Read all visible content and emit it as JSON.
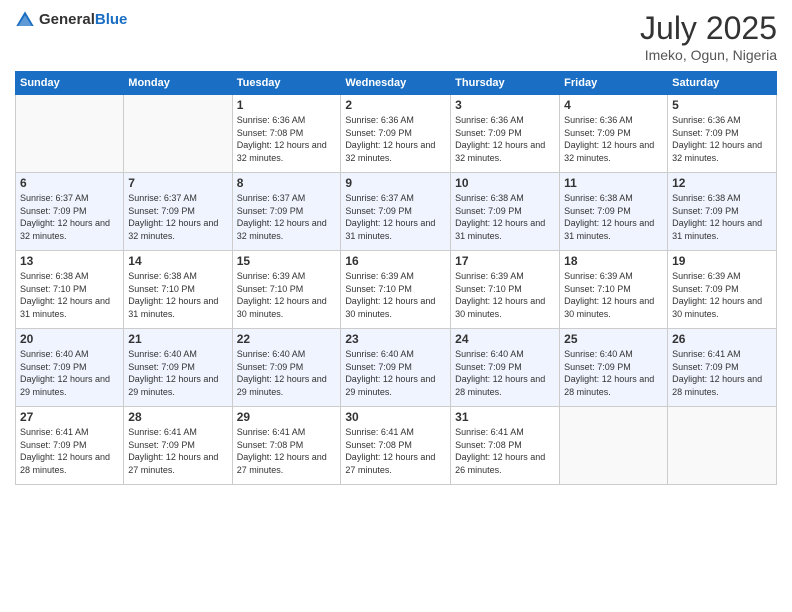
{
  "logo": {
    "general": "General",
    "blue": "Blue"
  },
  "title": {
    "month_year": "July 2025",
    "location": "Imeko, Ogun, Nigeria"
  },
  "weekdays": [
    "Sunday",
    "Monday",
    "Tuesday",
    "Wednesday",
    "Thursday",
    "Friday",
    "Saturday"
  ],
  "weeks": [
    [
      {
        "day": "",
        "sunrise": "",
        "sunset": "",
        "daylight": ""
      },
      {
        "day": "",
        "sunrise": "",
        "sunset": "",
        "daylight": ""
      },
      {
        "day": "1",
        "sunrise": "Sunrise: 6:36 AM",
        "sunset": "Sunset: 7:08 PM",
        "daylight": "Daylight: 12 hours and 32 minutes."
      },
      {
        "day": "2",
        "sunrise": "Sunrise: 6:36 AM",
        "sunset": "Sunset: 7:09 PM",
        "daylight": "Daylight: 12 hours and 32 minutes."
      },
      {
        "day": "3",
        "sunrise": "Sunrise: 6:36 AM",
        "sunset": "Sunset: 7:09 PM",
        "daylight": "Daylight: 12 hours and 32 minutes."
      },
      {
        "day": "4",
        "sunrise": "Sunrise: 6:36 AM",
        "sunset": "Sunset: 7:09 PM",
        "daylight": "Daylight: 12 hours and 32 minutes."
      },
      {
        "day": "5",
        "sunrise": "Sunrise: 6:36 AM",
        "sunset": "Sunset: 7:09 PM",
        "daylight": "Daylight: 12 hours and 32 minutes."
      }
    ],
    [
      {
        "day": "6",
        "sunrise": "Sunrise: 6:37 AM",
        "sunset": "Sunset: 7:09 PM",
        "daylight": "Daylight: 12 hours and 32 minutes."
      },
      {
        "day": "7",
        "sunrise": "Sunrise: 6:37 AM",
        "sunset": "Sunset: 7:09 PM",
        "daylight": "Daylight: 12 hours and 32 minutes."
      },
      {
        "day": "8",
        "sunrise": "Sunrise: 6:37 AM",
        "sunset": "Sunset: 7:09 PM",
        "daylight": "Daylight: 12 hours and 32 minutes."
      },
      {
        "day": "9",
        "sunrise": "Sunrise: 6:37 AM",
        "sunset": "Sunset: 7:09 PM",
        "daylight": "Daylight: 12 hours and 31 minutes."
      },
      {
        "day": "10",
        "sunrise": "Sunrise: 6:38 AM",
        "sunset": "Sunset: 7:09 PM",
        "daylight": "Daylight: 12 hours and 31 minutes."
      },
      {
        "day": "11",
        "sunrise": "Sunrise: 6:38 AM",
        "sunset": "Sunset: 7:09 PM",
        "daylight": "Daylight: 12 hours and 31 minutes."
      },
      {
        "day": "12",
        "sunrise": "Sunrise: 6:38 AM",
        "sunset": "Sunset: 7:09 PM",
        "daylight": "Daylight: 12 hours and 31 minutes."
      }
    ],
    [
      {
        "day": "13",
        "sunrise": "Sunrise: 6:38 AM",
        "sunset": "Sunset: 7:10 PM",
        "daylight": "Daylight: 12 hours and 31 minutes."
      },
      {
        "day": "14",
        "sunrise": "Sunrise: 6:38 AM",
        "sunset": "Sunset: 7:10 PM",
        "daylight": "Daylight: 12 hours and 31 minutes."
      },
      {
        "day": "15",
        "sunrise": "Sunrise: 6:39 AM",
        "sunset": "Sunset: 7:10 PM",
        "daylight": "Daylight: 12 hours and 30 minutes."
      },
      {
        "day": "16",
        "sunrise": "Sunrise: 6:39 AM",
        "sunset": "Sunset: 7:10 PM",
        "daylight": "Daylight: 12 hours and 30 minutes."
      },
      {
        "day": "17",
        "sunrise": "Sunrise: 6:39 AM",
        "sunset": "Sunset: 7:10 PM",
        "daylight": "Daylight: 12 hours and 30 minutes."
      },
      {
        "day": "18",
        "sunrise": "Sunrise: 6:39 AM",
        "sunset": "Sunset: 7:10 PM",
        "daylight": "Daylight: 12 hours and 30 minutes."
      },
      {
        "day": "19",
        "sunrise": "Sunrise: 6:39 AM",
        "sunset": "Sunset: 7:09 PM",
        "daylight": "Daylight: 12 hours and 30 minutes."
      }
    ],
    [
      {
        "day": "20",
        "sunrise": "Sunrise: 6:40 AM",
        "sunset": "Sunset: 7:09 PM",
        "daylight": "Daylight: 12 hours and 29 minutes."
      },
      {
        "day": "21",
        "sunrise": "Sunrise: 6:40 AM",
        "sunset": "Sunset: 7:09 PM",
        "daylight": "Daylight: 12 hours and 29 minutes."
      },
      {
        "day": "22",
        "sunrise": "Sunrise: 6:40 AM",
        "sunset": "Sunset: 7:09 PM",
        "daylight": "Daylight: 12 hours and 29 minutes."
      },
      {
        "day": "23",
        "sunrise": "Sunrise: 6:40 AM",
        "sunset": "Sunset: 7:09 PM",
        "daylight": "Daylight: 12 hours and 29 minutes."
      },
      {
        "day": "24",
        "sunrise": "Sunrise: 6:40 AM",
        "sunset": "Sunset: 7:09 PM",
        "daylight": "Daylight: 12 hours and 28 minutes."
      },
      {
        "day": "25",
        "sunrise": "Sunrise: 6:40 AM",
        "sunset": "Sunset: 7:09 PM",
        "daylight": "Daylight: 12 hours and 28 minutes."
      },
      {
        "day": "26",
        "sunrise": "Sunrise: 6:41 AM",
        "sunset": "Sunset: 7:09 PM",
        "daylight": "Daylight: 12 hours and 28 minutes."
      }
    ],
    [
      {
        "day": "27",
        "sunrise": "Sunrise: 6:41 AM",
        "sunset": "Sunset: 7:09 PM",
        "daylight": "Daylight: 12 hours and 28 minutes."
      },
      {
        "day": "28",
        "sunrise": "Sunrise: 6:41 AM",
        "sunset": "Sunset: 7:09 PM",
        "daylight": "Daylight: 12 hours and 27 minutes."
      },
      {
        "day": "29",
        "sunrise": "Sunrise: 6:41 AM",
        "sunset": "Sunset: 7:08 PM",
        "daylight": "Daylight: 12 hours and 27 minutes."
      },
      {
        "day": "30",
        "sunrise": "Sunrise: 6:41 AM",
        "sunset": "Sunset: 7:08 PM",
        "daylight": "Daylight: 12 hours and 27 minutes."
      },
      {
        "day": "31",
        "sunrise": "Sunrise: 6:41 AM",
        "sunset": "Sunset: 7:08 PM",
        "daylight": "Daylight: 12 hours and 26 minutes."
      },
      {
        "day": "",
        "sunrise": "",
        "sunset": "",
        "daylight": ""
      },
      {
        "day": "",
        "sunrise": "",
        "sunset": "",
        "daylight": ""
      }
    ]
  ]
}
